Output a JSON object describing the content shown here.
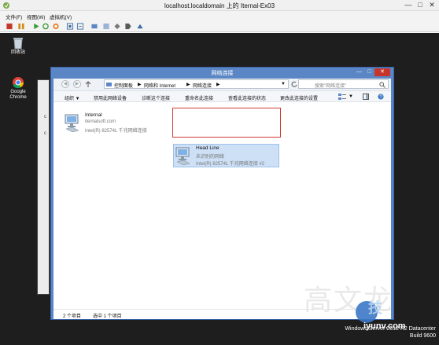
{
  "host": {
    "title": "localhost.localdomain 上的 Iternal-Ex03",
    "minimize": "—",
    "maximize": "□",
    "close": "✕",
    "menus": [
      "文件(F)",
      "视图(W)",
      "虚拟机(V)"
    ]
  },
  "desktop": {
    "icons": [
      {
        "label": "回收站",
        "icon": "recycle-bin-icon"
      },
      {
        "label": "Google Chrome",
        "icon": "chrome-icon"
      }
    ],
    "bg_window_chars": [
      "c",
      "c"
    ]
  },
  "explorer": {
    "title": "网络连接",
    "breadcrumb": [
      "控制面板",
      "网络和 Internet",
      "网络连接"
    ],
    "search_placeholder": "搜索\"网络连接\"",
    "commands": [
      "组织 ▼",
      "禁用此网络设备",
      "诊断这个连接",
      "重命名此连接",
      "查看此连接的状态",
      "更改此连接的设置"
    ],
    "connections": [
      {
        "name": "Internal",
        "status": "iternalsoft.com",
        "adapter": "Intel(R) 82574L 千兆网络连接"
      },
      {
        "name": "Head Line",
        "status": "未识别的网络",
        "adapter": "Intel(R) 82574L 千兆网络连接 #2"
      }
    ],
    "status": {
      "count": "2 个项目",
      "selected": "选中 1 个项目"
    }
  },
  "os_info": {
    "edition": "Windows Server 2012 R2 Datacenter",
    "build": "Build 9600"
  },
  "watermark": {
    "text": "高文龙",
    "site": "iyunv.com",
    "logo": "技"
  }
}
